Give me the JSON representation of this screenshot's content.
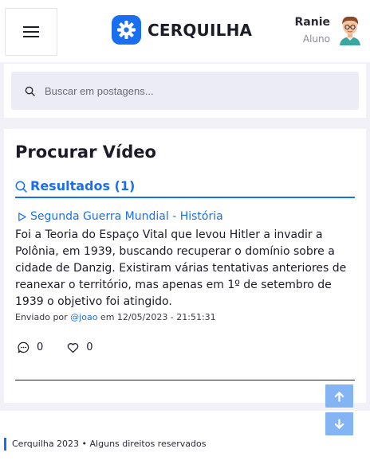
{
  "brand": {
    "name": "CERQUILHA"
  },
  "user": {
    "name": "Ranie",
    "role": "Aluno"
  },
  "search": {
    "placeholder": "Buscar em postagens..."
  },
  "section": {
    "title": "Procurar Vídeo",
    "results_label": "Resultados (1)"
  },
  "post": {
    "title": "Segunda Guerra Mundial - História",
    "body": "Foi a Teoria do Espaço Vital que levou Hitler a invadir a Polônia, em 1939, buscando recuperar o domínio sobre a cidade de Danzig. Existiram várias tentativas anteriores de reanexar o território, mas apenas em 1º de setembro de 1939 o objetivo foi atingido.",
    "meta_prefix": "Enviado por ",
    "author": "@joao",
    "meta_suffix": " em 12/05/2023 - 21:51:31",
    "comments": "0",
    "likes": "0"
  },
  "footer": {
    "text": "Cerquilha 2023 • Alguns direitos reservados"
  },
  "colors": {
    "accent": "#1a6ff0",
    "scroll_button": "#85b4f5",
    "page_bg": "#f1f1f7"
  },
  "icons": {
    "menu": "hamburger-icon",
    "logo": "gear-icon",
    "search": "search-icon",
    "results": "search-icon",
    "post": "play-icon",
    "comments": "comment-icon",
    "likes": "heart-icon",
    "scroll_up": "arrow-up-icon",
    "scroll_down": "arrow-down-icon"
  }
}
